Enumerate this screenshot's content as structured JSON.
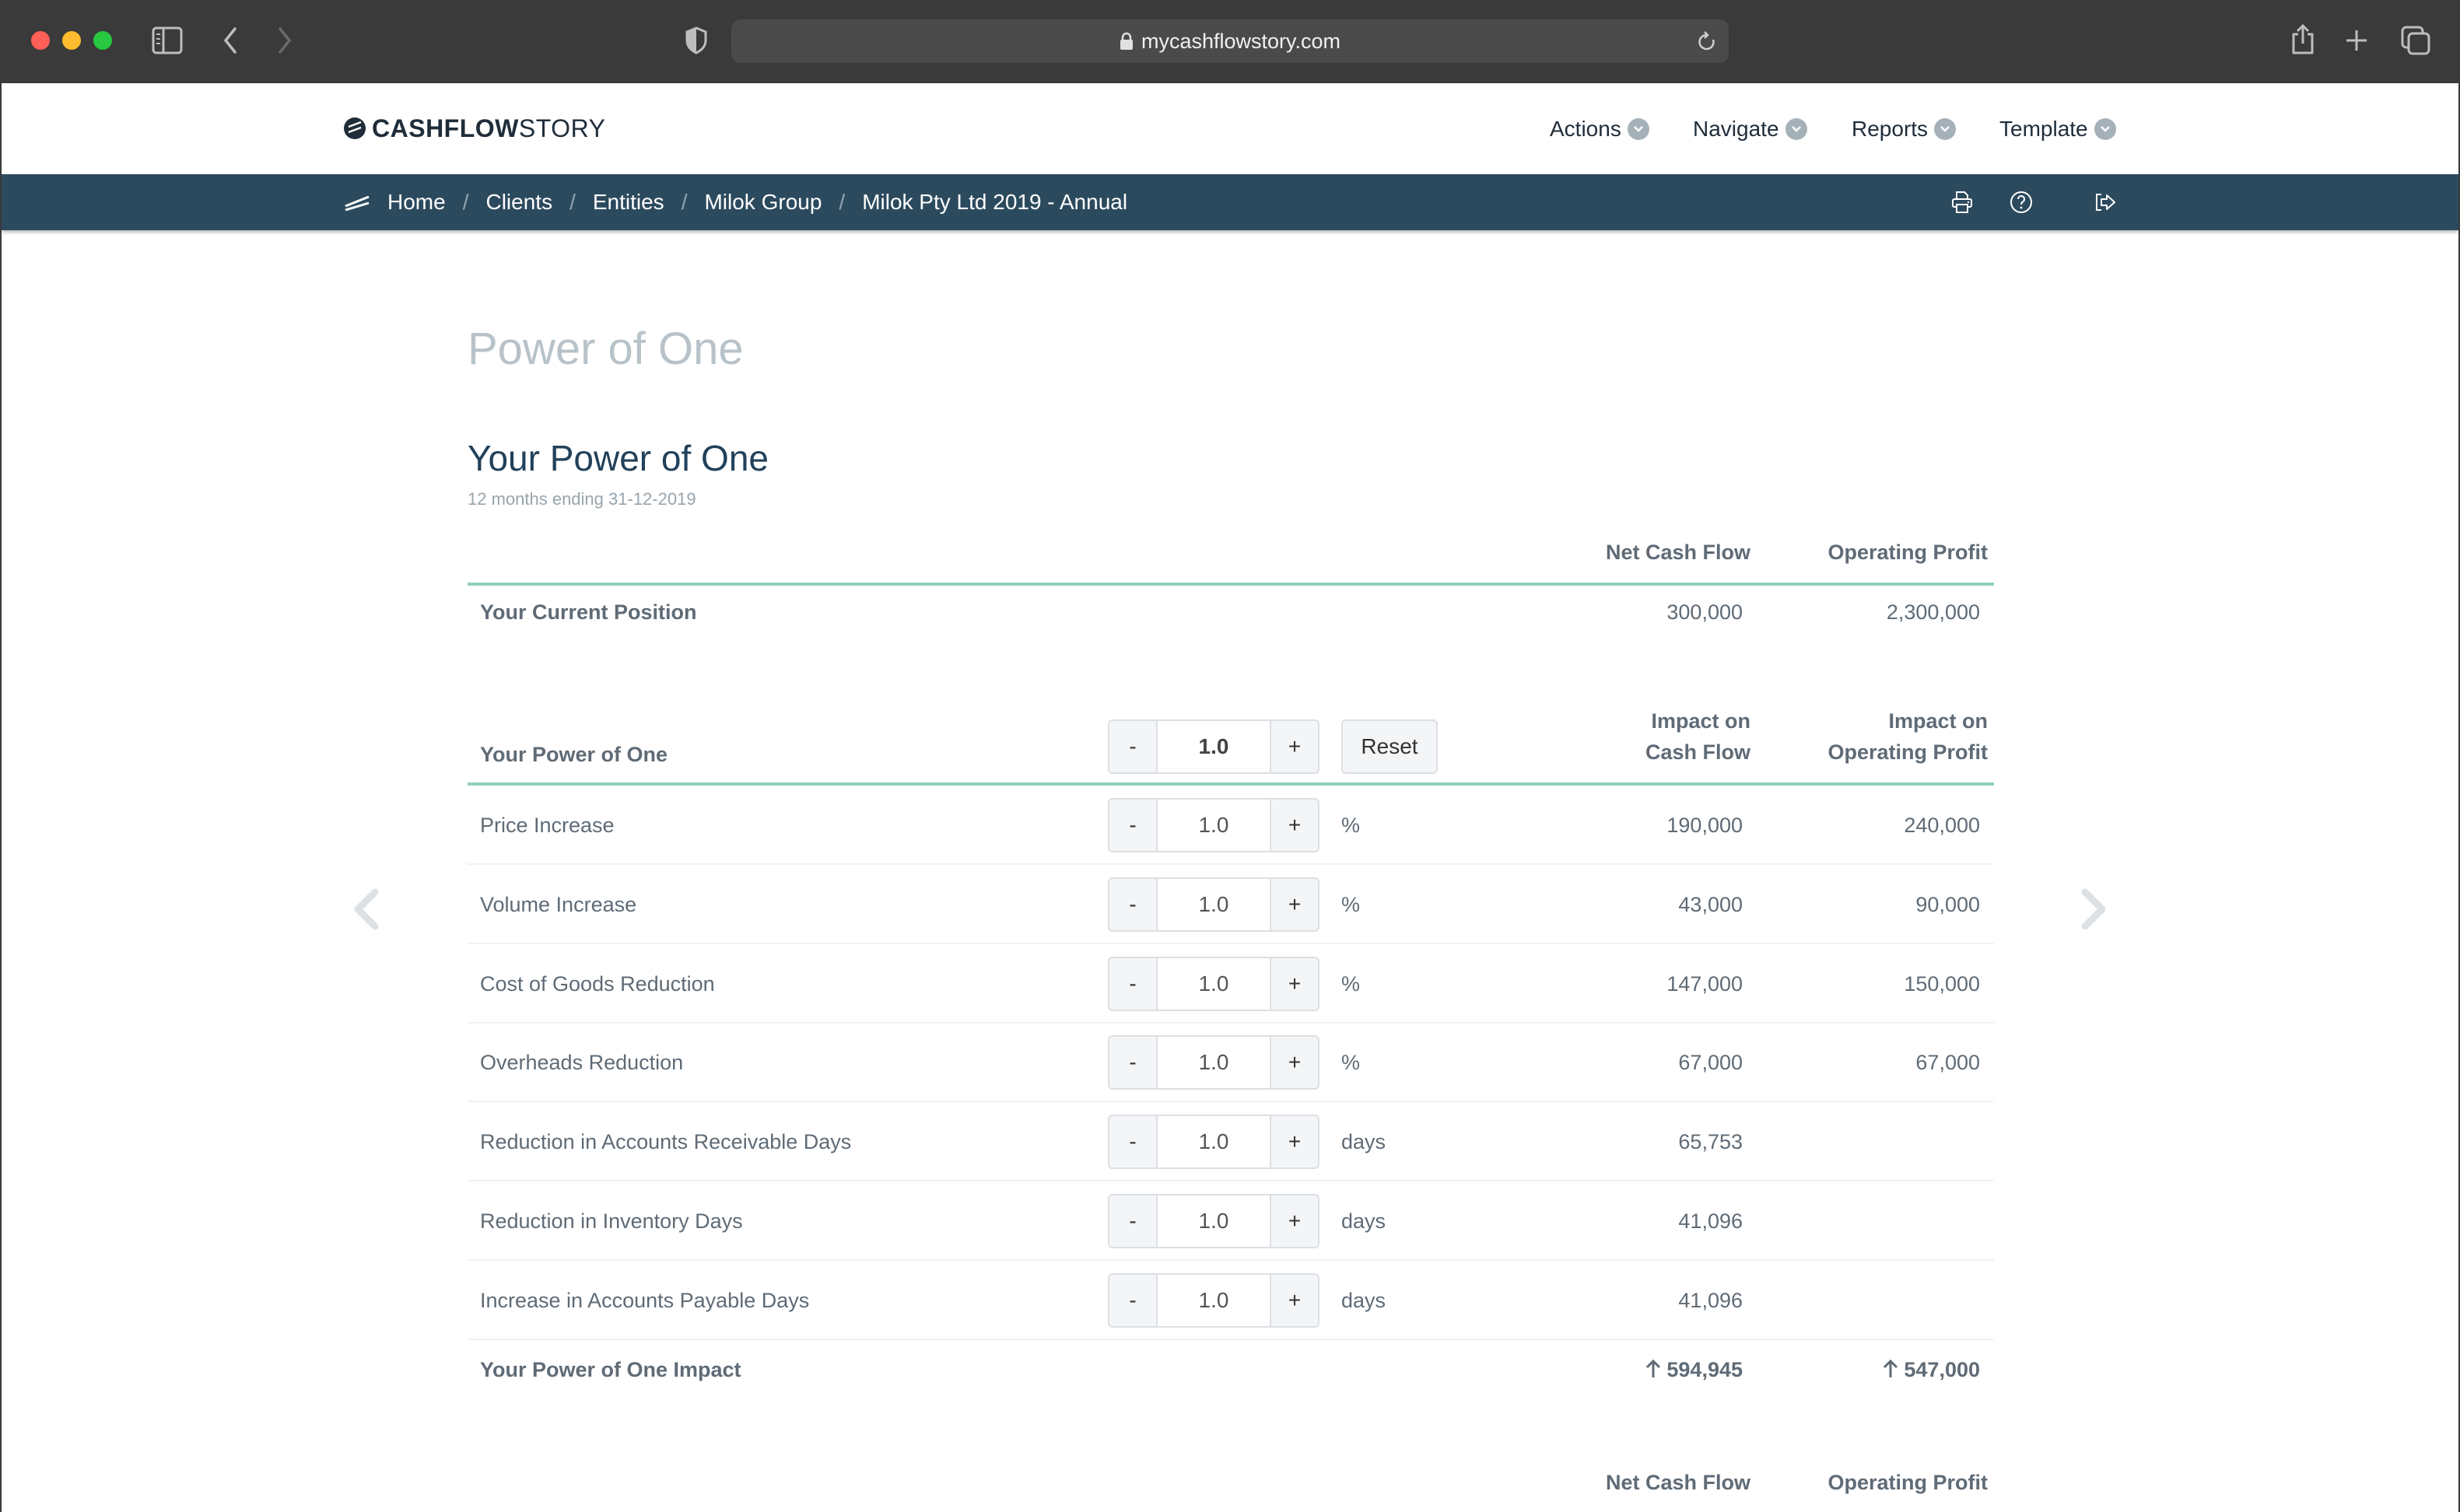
{
  "browser": {
    "url": "mycashflowstory.com"
  },
  "header": {
    "logo_bold": "CASHFLOW",
    "logo_light": "STORY",
    "menus": [
      {
        "label": "Actions"
      },
      {
        "label": "Navigate"
      },
      {
        "label": "Reports"
      },
      {
        "label": "Template"
      }
    ]
  },
  "breadcrumb": [
    {
      "label": "Home"
    },
    {
      "label": "Clients"
    },
    {
      "label": "Entities"
    },
    {
      "label": "Milok Group"
    },
    {
      "label": "Milok Pty Ltd 2019 - Annual"
    }
  ],
  "page": {
    "title": "Power of One",
    "section_title": "Your Power of One",
    "period": "12 months ending 31-12-2019"
  },
  "current_position": {
    "col_headers": [
      "Net Cash Flow",
      "Operating Profit"
    ],
    "label": "Your Current Position",
    "net_cash_flow": "300,000",
    "operating_profit": "2,300,000"
  },
  "power_of_one": {
    "label": "Your Power of One",
    "master_value": "1.0",
    "minus_label": "-",
    "plus_label": "+",
    "reset_label": "Reset",
    "col_header_1_line1": "Impact on",
    "col_header_1_line2": "Cash Flow",
    "col_header_2_line1": "Impact on",
    "col_header_2_line2": "Operating Profit",
    "rows": [
      {
        "label": "Price Increase",
        "value": "1.0",
        "unit": "%",
        "cash_flow": "190,000",
        "operating_profit": "240,000"
      },
      {
        "label": "Volume Increase",
        "value": "1.0",
        "unit": "%",
        "cash_flow": "43,000",
        "operating_profit": "90,000"
      },
      {
        "label": "Cost of Goods Reduction",
        "value": "1.0",
        "unit": "%",
        "cash_flow": "147,000",
        "operating_profit": "150,000"
      },
      {
        "label": "Overheads Reduction",
        "value": "1.0",
        "unit": "%",
        "cash_flow": "67,000",
        "operating_profit": "67,000"
      },
      {
        "label": "Reduction in Accounts Receivable Days",
        "value": "1.0",
        "unit": "days",
        "cash_flow": "65,753",
        "operating_profit": ""
      },
      {
        "label": "Reduction in Inventory Days",
        "value": "1.0",
        "unit": "days",
        "cash_flow": "41,096",
        "operating_profit": ""
      },
      {
        "label": "Increase in Accounts Payable Days",
        "value": "1.0",
        "unit": "days",
        "cash_flow": "41,096",
        "operating_profit": ""
      }
    ],
    "impact_label": "Your Power of One Impact",
    "impact_cash_flow": "594,945",
    "impact_operating_profit": "547,000"
  },
  "next_section": {
    "col_headers": [
      "Net Cash Flow",
      "Operating Profit"
    ]
  },
  "colors": {
    "breadcrumb_bar": "#2c4a5e",
    "accent_line": "#8fd0bb",
    "heading": "#22415a",
    "muted_title": "#b7c2c9"
  }
}
